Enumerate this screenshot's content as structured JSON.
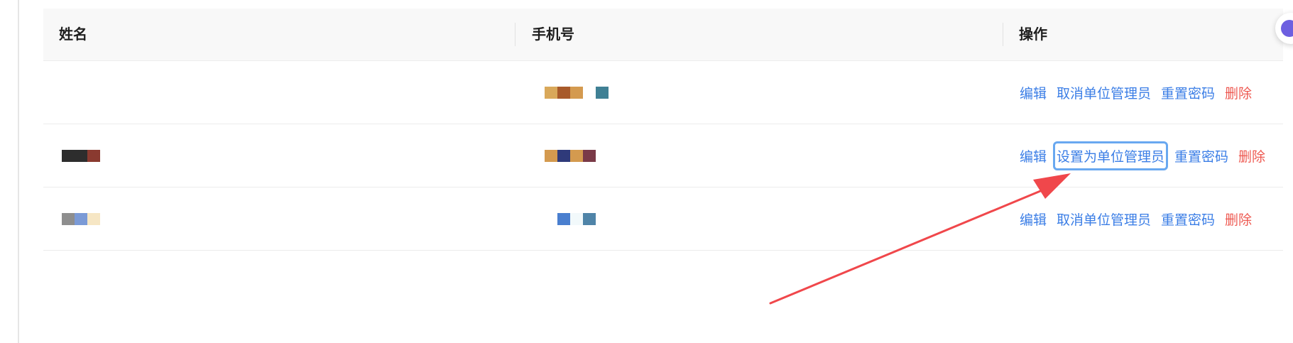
{
  "table": {
    "columns": [
      "姓名",
      "手机号",
      "操作"
    ],
    "rows": [
      {
        "actions": [
          "编辑",
          "取消单位管理员",
          "重置密码",
          "删除"
        ]
      },
      {
        "actions": [
          "编辑",
          "设置为单位管理员",
          "重置密码",
          "删除"
        ]
      },
      {
        "actions": [
          "编辑",
          "取消单位管理员",
          "重置密码",
          "删除"
        ]
      }
    ]
  },
  "colors": {
    "link": "#3b7ee6",
    "danger": "#ee5a52",
    "highlight_border": "#69a8f0",
    "arrow": "#f0474b"
  }
}
